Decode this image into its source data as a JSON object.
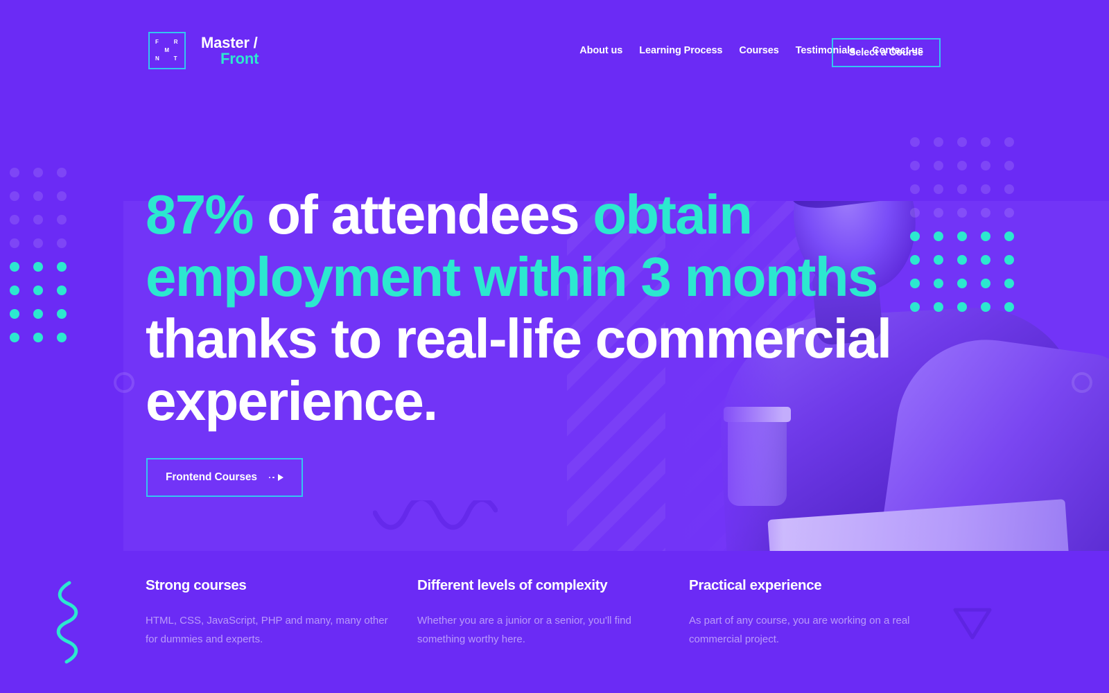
{
  "brand": {
    "logo_letters": [
      "F",
      "R",
      "M",
      "N",
      "T"
    ],
    "name_line1": "Master /",
    "name_line2": "Front",
    "accent_color": "#2CE8CF",
    "border_color": "#33C6F0"
  },
  "nav": {
    "items": [
      {
        "label": "About us"
      },
      {
        "label": "Learning Process"
      },
      {
        "label": "Courses"
      },
      {
        "label": "Testimonials"
      },
      {
        "label": "Contact us"
      }
    ],
    "cta_label": "Select a Course"
  },
  "hero": {
    "headline": {
      "part1_accent": "87%",
      "part2": " of attendees ",
      "part3_accent": "obtain employment within 3 months",
      "part4": " thanks to real-life commercial experience."
    },
    "cta_label": "Frontend Courses",
    "cta_icon": "dotted-arrow-icon"
  },
  "features": [
    {
      "title": "Strong courses",
      "text": "HTML, CSS, JavaScript, PHP and many, many other for dummies and experts."
    },
    {
      "title": "Different levels of complexity",
      "text": "Whether you are a junior or a senior, you'll find something worthy here."
    },
    {
      "title": "Practical experience",
      "text": "As part of any course, you are working on a real commercial project."
    }
  ],
  "theme": {
    "background": "#6B2BF5",
    "panel": "#7234F7",
    "accent_teal": "#2CE8CF",
    "accent_blue": "#33C6F0",
    "text": "#FFFFFF"
  },
  "decor": {
    "dots_left": {
      "columns": 3,
      "rows": 8,
      "faint_rows": 4,
      "teal_rows": 4
    },
    "dots_right": {
      "columns": 5,
      "rows": 8,
      "faint_rows": 4,
      "teal_rows": 4
    },
    "shapes": [
      "ring-left",
      "ring-right",
      "wave-line",
      "teal-squiggle",
      "triangle-outline",
      "diagonal-stripes"
    ]
  }
}
